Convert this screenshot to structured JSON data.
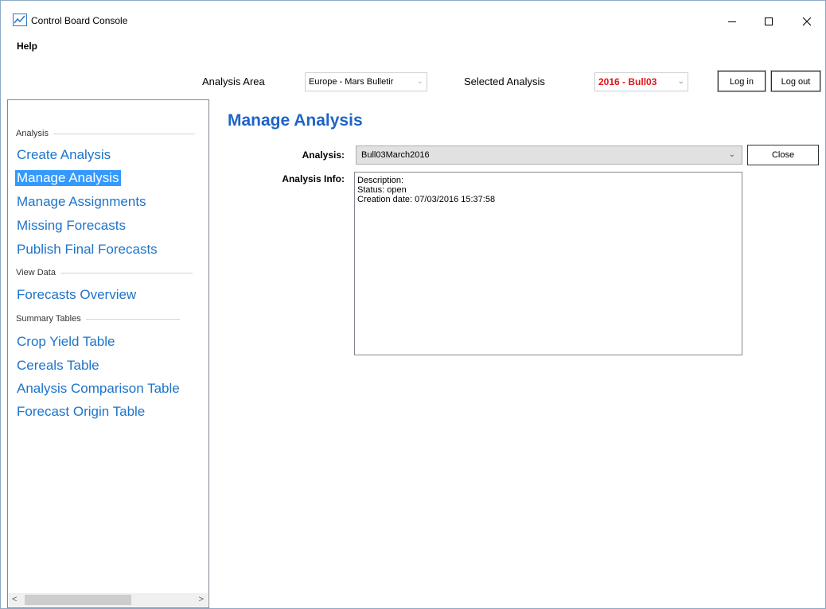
{
  "window": {
    "title": "Control Board Console",
    "controls": {
      "minimize": "–",
      "maximize": "☐",
      "close": "✕"
    }
  },
  "menu": {
    "items": [
      {
        "label": "Help"
      }
    ]
  },
  "toolbar": {
    "analysis_area_label": "Analysis Area",
    "analysis_area_value": "Europe - Mars Bulletir",
    "selected_analysis_label": "Selected Analysis",
    "selected_analysis_value": "2016 - Bull03",
    "selected_analysis_color": "#e0151a",
    "login_label": "Log in",
    "logout_label": "Log out"
  },
  "nav": {
    "sections": [
      {
        "title": "Analysis",
        "items": [
          {
            "label": "Create Analysis",
            "active": false
          },
          {
            "label": "Manage Analysis",
            "active": true
          },
          {
            "label": "Manage Assignments",
            "active": false
          },
          {
            "label": "Missing Forecasts",
            "active": false
          },
          {
            "label": "Publish Final Forecasts",
            "active": false
          }
        ]
      },
      {
        "title": "View Data",
        "items": [
          {
            "label": "Forecasts Overview",
            "active": false
          }
        ]
      },
      {
        "title": "Summary Tables",
        "items": [
          {
            "label": "Crop Yield Table",
            "active": false
          },
          {
            "label": "Cereals Table",
            "active": false
          },
          {
            "label": "Analysis Comparison Table",
            "active": false
          },
          {
            "label": "Forecast Origin Table",
            "active": false
          }
        ]
      }
    ],
    "scroll_left": "<",
    "scroll_right": ">"
  },
  "main": {
    "title": "Manage Analysis",
    "analysis_label": "Analysis:",
    "analysis_value": "Bull03March2016",
    "close_label": "Close",
    "info_label": "Analysis Info:",
    "info_lines": [
      "Description:",
      "Status: open",
      "Creation date: 07/03/2016 15:37:58"
    ]
  },
  "colors": {
    "link": "#1e74c9",
    "active_bg": "#3399ff",
    "title": "#1e64c8"
  }
}
